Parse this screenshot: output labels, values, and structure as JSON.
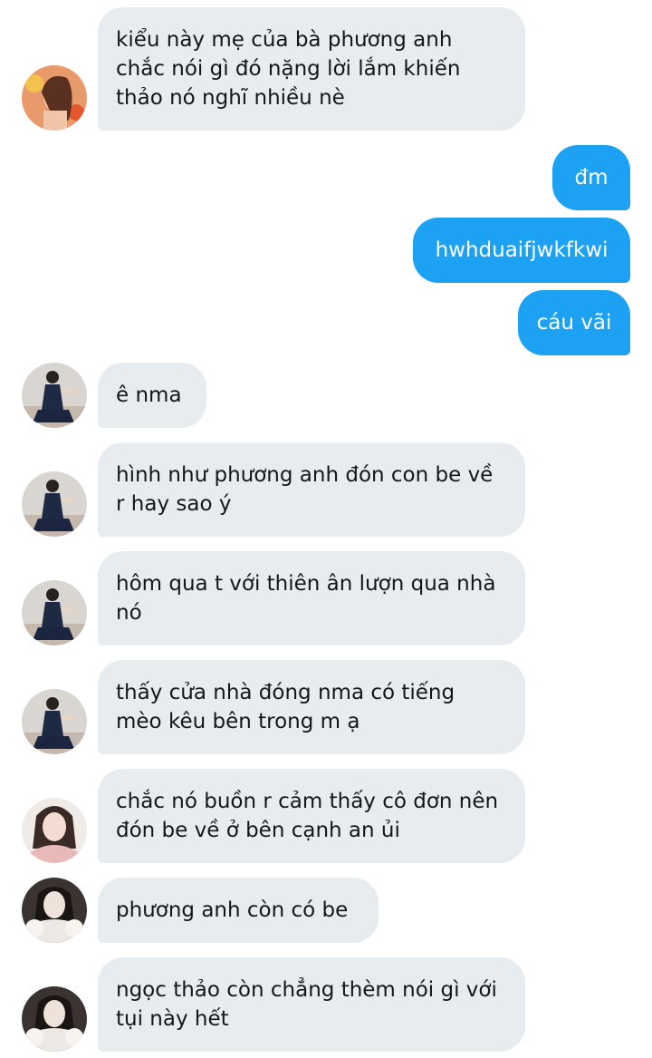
{
  "messages": [
    {
      "side": "in",
      "text": "kiểu này mẹ của bà phương anh chắc nói gì đó nặng lời lắm khiến thảo nó nghĩ nhiều nè",
      "avatar": "avatar-girl-flowers"
    },
    {
      "side": "out",
      "text": "đm"
    },
    {
      "side": "out",
      "text": "hwhduaifjwkfkwi"
    },
    {
      "side": "out",
      "text": "cáu vãi"
    },
    {
      "side": "in",
      "text": "ê nma",
      "avatar": "avatar-girl-black-dress"
    },
    {
      "side": "in",
      "text": "hình như phương anh đón con be về r hay sao ý",
      "avatar": "avatar-girl-black-dress"
    },
    {
      "side": "in",
      "text": "hôm qua t với thiên ân lượn qua nhà nó",
      "avatar": "avatar-girl-black-dress"
    },
    {
      "side": "in",
      "text": "thấy cửa nhà đóng nma có tiếng mèo kêu bên trong m ạ",
      "avatar": "avatar-girl-black-dress"
    },
    {
      "side": "in",
      "text": "chắc nó buồn r cảm thấy cô đơn nên đón be về ở bên cạnh an ủi",
      "avatar": "avatar-girl-pink"
    },
    {
      "side": "in",
      "text": "phương anh còn có be",
      "avatar": "avatar-girl-fur"
    },
    {
      "side": "in",
      "text": "ngọc thảo còn chẳng thèm nói gì với tụi này hết",
      "avatar": "avatar-girl-fur"
    }
  ],
  "colors": {
    "incoming": "#e6ecf0",
    "outgoing": "#1da1f2",
    "text": "#14171a"
  }
}
